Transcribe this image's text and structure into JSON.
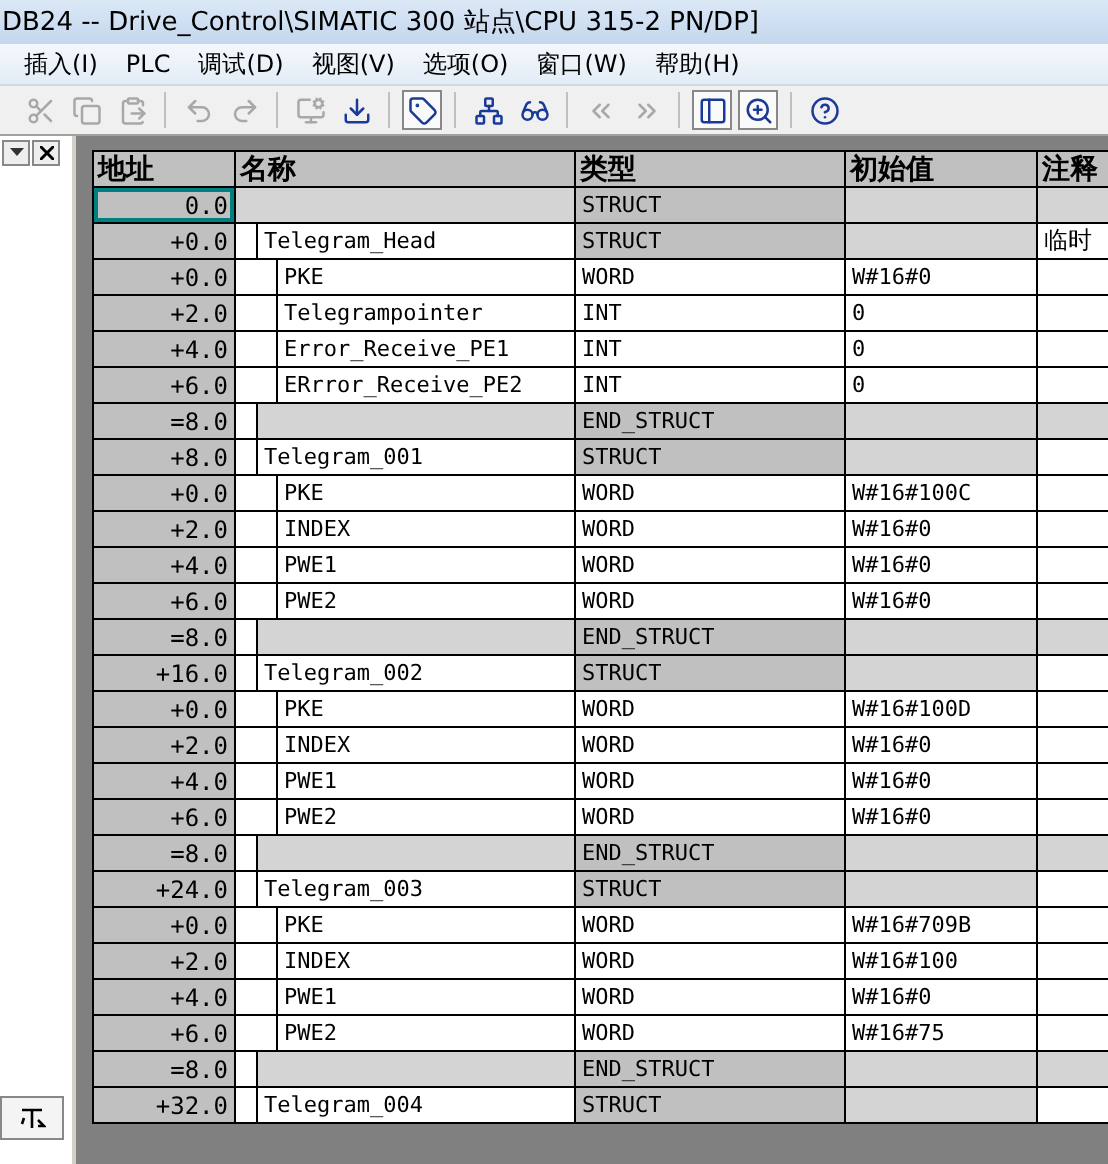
{
  "window": {
    "title": "DB24 -- Drive_Control\\SIMATIC 300 站点\\CPU 315-2 PN/DP]"
  },
  "menu": [
    "插入(I)",
    "PLC",
    "调试(D)",
    "视图(V)",
    "选项(O)",
    "窗口(W)",
    "帮助(H)"
  ],
  "toolbar": [
    {
      "disabled": true,
      "pressed": false
    },
    {
      "disabled": true,
      "pressed": false
    },
    {
      "disabled": true,
      "pressed": false
    },
    {
      "disabled": true,
      "pressed": false
    },
    {
      "disabled": true,
      "pressed": false
    },
    {
      "disabled": true,
      "pressed": false
    },
    {
      "disabled": false,
      "pressed": false
    },
    {
      "disabled": false,
      "pressed": true
    },
    {
      "disabled": false,
      "pressed": false
    },
    {
      "disabled": false,
      "pressed": false
    },
    {
      "disabled": true,
      "pressed": false
    },
    {
      "disabled": true,
      "pressed": false
    },
    {
      "disabled": false,
      "pressed": true
    },
    {
      "disabled": false,
      "pressed": true
    },
    {
      "disabled": false,
      "pressed": false
    }
  ],
  "table": {
    "columns": [
      "地址",
      "名称",
      "类型",
      "初始值",
      "注释"
    ],
    "rows": [
      {
        "kind": "struct",
        "address": "0.0",
        "type": "STRUCT",
        "selected": true,
        "children": [
          {
            "kind": "struct",
            "address": "+0.0",
            "name": "Telegram_Head",
            "type": "STRUCT",
            "comment": "临时",
            "selected": false,
            "children": [
              {
                "kind": "element",
                "address": "+0.0",
                "name": "PKE",
                "type": "WORD",
                "initial": "W#16#0",
                "selected": false
              },
              {
                "kind": "element",
                "address": "+2.0",
                "name": "Telegrampointer",
                "type": "INT",
                "initial": "0",
                "selected": false
              },
              {
                "kind": "element",
                "address": "+4.0",
                "name": "Error_Receive_PE1",
                "type": "INT",
                "initial": "0",
                "selected": false
              },
              {
                "kind": "element",
                "address": "+6.0",
                "name": "ERrror_Receive_PE2",
                "type": "INT",
                "initial": "0",
                "selected": false
              }
            ],
            "end": {
              "address": "=8.0",
              "type": "END_STRUCT",
              "selected": false
            }
          },
          {
            "kind": "struct",
            "address": "+8.0",
            "name": "Telegram_001",
            "type": "STRUCT",
            "selected": false,
            "children": [
              {
                "kind": "element",
                "address": "+0.0",
                "name": "PKE",
                "type": "WORD",
                "initial": "W#16#100C",
                "selected": false
              },
              {
                "kind": "element",
                "address": "+2.0",
                "name": "INDEX",
                "type": "WORD",
                "initial": "W#16#0",
                "selected": false
              },
              {
                "kind": "element",
                "address": "+4.0",
                "name": "PWE1",
                "type": "WORD",
                "initial": "W#16#0",
                "selected": false
              },
              {
                "kind": "element",
                "address": "+6.0",
                "name": "PWE2",
                "type": "WORD",
                "initial": "W#16#0",
                "selected": false
              }
            ],
            "end": {
              "address": "=8.0",
              "type": "END_STRUCT",
              "selected": false
            }
          },
          {
            "kind": "struct",
            "address": "+16.0",
            "name": "Telegram_002",
            "type": "STRUCT",
            "selected": false,
            "children": [
              {
                "kind": "element",
                "address": "+0.0",
                "name": "PKE",
                "type": "WORD",
                "initial": "W#16#100D",
                "selected": false
              },
              {
                "kind": "element",
                "address": "+2.0",
                "name": "INDEX",
                "type": "WORD",
                "initial": "W#16#0",
                "selected": false
              },
              {
                "kind": "element",
                "address": "+4.0",
                "name": "PWE1",
                "type": "WORD",
                "initial": "W#16#0",
                "selected": false
              },
              {
                "kind": "element",
                "address": "+6.0",
                "name": "PWE2",
                "type": "WORD",
                "initial": "W#16#0",
                "selected": false
              }
            ],
            "end": {
              "address": "=8.0",
              "type": "END_STRUCT",
              "selected": false
            }
          },
          {
            "kind": "struct",
            "address": "+24.0",
            "name": "Telegram_003",
            "type": "STRUCT",
            "selected": false,
            "children": [
              {
                "kind": "element",
                "address": "+0.0",
                "name": "PKE",
                "type": "WORD",
                "initial": "W#16#709B",
                "selected": false
              },
              {
                "kind": "element",
                "address": "+2.0",
                "name": "INDEX",
                "type": "WORD",
                "initial": "W#16#100",
                "selected": false
              },
              {
                "kind": "element",
                "address": "+4.0",
                "name": "PWE1",
                "type": "WORD",
                "initial": "W#16#0",
                "selected": false
              },
              {
                "kind": "element",
                "address": "+6.0",
                "name": "PWE2",
                "type": "WORD",
                "initial": "W#16#75",
                "selected": false
              }
            ],
            "end": {
              "address": "=8.0",
              "type": "END_STRUCT",
              "selected": false
            }
          },
          {
            "kind": "struct",
            "address": "+32.0",
            "name": "Telegram_004",
            "type": "STRUCT",
            "selected": false
          }
        ]
      }
    ]
  }
}
